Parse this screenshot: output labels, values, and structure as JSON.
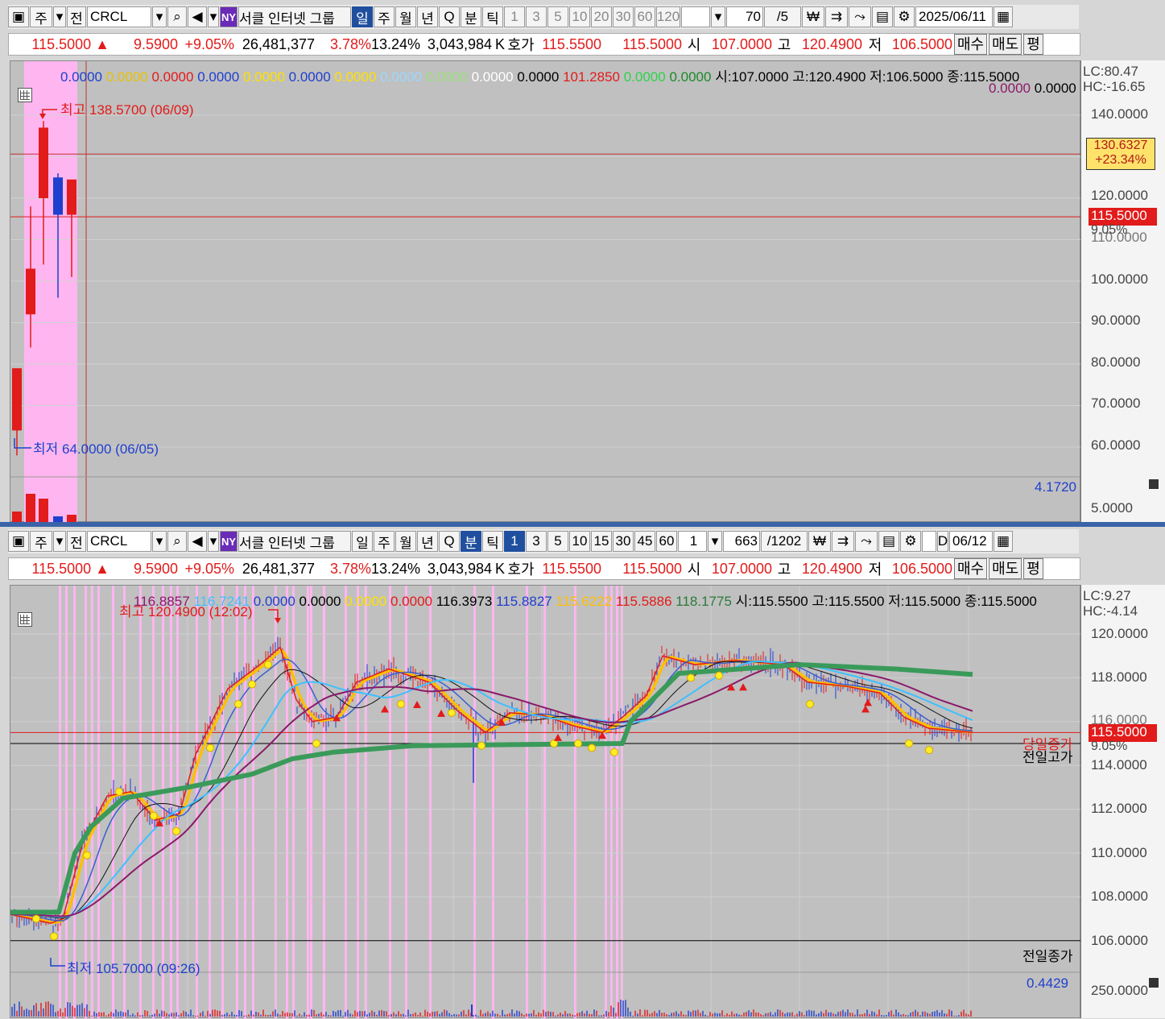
{
  "toolbar": {
    "ju": "주",
    "jeon": "전",
    "symbol": "CRCL",
    "exchange": "NY",
    "group": "서클 인터넷 그룹",
    "periods": [
      "일",
      "주",
      "월",
      "년",
      "Q",
      "분",
      "틱"
    ],
    "intervals_top": [
      "1",
      "3",
      "5",
      "10",
      "20",
      "30",
      "60",
      "120"
    ],
    "intervals_bottom": [
      "1",
      "3",
      "5",
      "10",
      "15",
      "30",
      "45",
      "60",
      "1"
    ],
    "top_count": "70",
    "top_count_total": "/5",
    "bottom_count": "663",
    "bottom_count_total": "/1202",
    "top_date": "2025/06/11",
    "bottom_date": "06/12",
    "d_label": "D",
    "won_icon": "₩"
  },
  "quote": {
    "price": "115.5000",
    "change": "9.5900",
    "change_pct": "+9.05%",
    "volume": "26,481,377",
    "ratio1": "3.78%",
    "ratio2": "13.24%",
    "amount": "3,043,984",
    "unit": "K",
    "hoga_label": "호가",
    "ask": "115.5500",
    "bid": "115.5000",
    "open_label": "시",
    "open": "107.0000",
    "high_label": "고",
    "high": "120.4900",
    "low_label": "저",
    "low": "106.5000",
    "buy": "매수",
    "sell": "매도",
    "flat": "평"
  },
  "top_chart": {
    "legend_values": [
      "0.0000",
      "0.0000",
      "0.0000",
      "0.0000",
      "0.0000",
      "0.0000",
      "0.0000",
      "0.0000",
      "0.0000",
      "0.0000",
      "0.0000",
      "101.2850",
      "0.0000",
      "0.0000"
    ],
    "ohlc_text": "시:107.0000 고:120.4900 저:106.5000 종:115.5000",
    "legend_line2": [
      "0.0000",
      "0.0000"
    ],
    "lc": "LC:80.47",
    "hc": "HC:-16.65",
    "high_note": "최고 138.5700 (06/09)",
    "low_note": "최저 64.0000 (06/05)",
    "axis": [
      "140.0000",
      "130.0000",
      "120.0000",
      "110.0000",
      "100.0000",
      "90.0000",
      "80.0000",
      "70.0000",
      "60.0000"
    ],
    "tag1_price": "130.6327",
    "tag1_pct": "+23.34%",
    "tag2_price": "115.5000",
    "tag2_pct": "9.05%",
    "vol_value": "4.1720",
    "vol_axis": "5.0000",
    "candles": [
      {
        "o": 64.0,
        "h": 76.0,
        "l": 64.0,
        "c": 79.0
      },
      {
        "o": 92.0,
        "h": 118.0,
        "l": 90.0,
        "c": 103.0
      },
      {
        "o": 120.0,
        "h": 138.57,
        "l": 110.0,
        "c": 137.0
      },
      {
        "o": 125.0,
        "h": 126.0,
        "l": 102.0,
        "c": 116.0
      },
      {
        "o": 116.0,
        "h": 121.0,
        "l": 107.0,
        "c": 124.5
      }
    ]
  },
  "bottom_chart": {
    "legend_values": [
      "116.8857",
      "116.7241",
      "0.0000",
      "0.0000",
      "0.0000",
      "0.0000",
      "116.3973",
      "115.8827",
      "115.6222",
      "115.5886",
      "118.1775"
    ],
    "ohlc_text": "시:115.5500 고:115.5500 저:115.5000 종:115.5000",
    "lc": "LC:9.27",
    "hc": "HC:-4.14",
    "high_note": "최고 120.4900 (12:02)",
    "low_note": "최저 105.7000 (09:26)",
    "axis": [
      "120.0000",
      "118.0000",
      "116.0000",
      "114.0000",
      "112.0000",
      "110.0000",
      "108.0000",
      "106.0000"
    ],
    "tag_price": "115.5000",
    "tag_pct": "9.05%",
    "line_label_1": "당일종가",
    "line_label_2": "전일고가",
    "line_label_3": "전일종가",
    "vol_value": "0.4429",
    "vol_axis": "250.0000"
  },
  "colors": {
    "up": "#e21b1b",
    "down": "#1f3fcf",
    "pink": "#ffb6f0",
    "green": "#3a9a5a",
    "yellow": "#ffd21f"
  }
}
